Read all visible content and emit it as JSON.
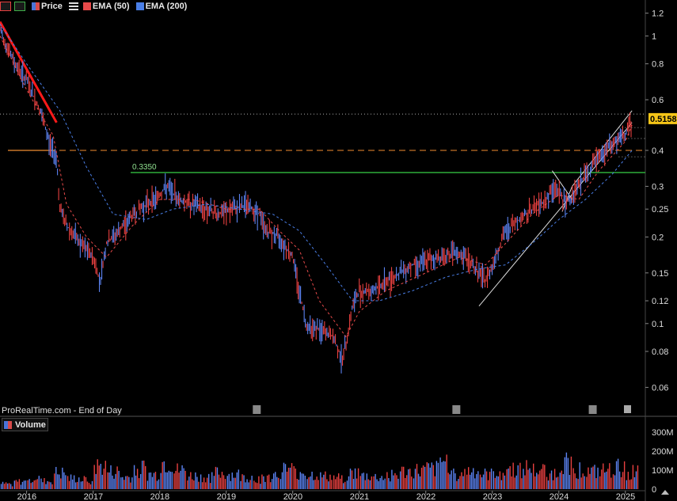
{
  "toolbar": {
    "price_label": "Price",
    "ema50_label": "EMA (50)",
    "ema200_label": "EMA (200)"
  },
  "watermark": "ProRealTime.com - End of Day",
  "volume_label": "Volume",
  "colors": {
    "background": "#000000",
    "up_bar": "#5b82f0",
    "down_bar": "#e84040",
    "ema50": "#e84a4a",
    "ema200": "#4a7fe8",
    "support_line": "#2fae3a",
    "orange_line": "#f08c30",
    "downtrend_line": "#ff1a1a",
    "price_badge": "#f5c518"
  },
  "price_badge": "0.5158",
  "support_label": "0.3350",
  "chart_data": [
    {
      "type": "line",
      "name": "price",
      "log_scale": true,
      "y_ticks": [
        "1.2",
        "1",
        "0.8",
        "0.6",
        "0.5158",
        "0.4",
        "0.3",
        "0.25",
        "0.2",
        "0.15",
        "0.12",
        "0.1",
        "0.08",
        "0.06"
      ],
      "y_tick_values": [
        1.2,
        1,
        0.8,
        0.6,
        0.4,
        0.3,
        0.25,
        0.2,
        0.15,
        0.12,
        0.1,
        0.08,
        0.06
      ],
      "x_ticks": [
        "2016",
        "2017",
        "2018",
        "2019",
        "2020",
        "2021",
        "2022",
        "2023",
        "2024",
        "2025"
      ],
      "x_tick_values": [
        2016,
        2017,
        2018,
        2019,
        2020,
        2021,
        2022,
        2023,
        2024,
        2025
      ],
      "xlim": [
        2015.6,
        2025.3
      ],
      "ylim": [
        0.052,
        1.3
      ],
      "series": [
        {
          "name": "Price",
          "x": [
            2015.6,
            2015.8,
            2016.0,
            2016.2,
            2016.35,
            2016.45,
            2016.5,
            2016.6,
            2016.8,
            2017.0,
            2017.1,
            2017.2,
            2017.4,
            2017.6,
            2017.8,
            2018.0,
            2018.1,
            2018.3,
            2018.5,
            2018.7,
            2018.9,
            2019.1,
            2019.3,
            2019.5,
            2019.6,
            2019.8,
            2020.0,
            2020.1,
            2020.2,
            2020.4,
            2020.6,
            2020.75,
            2020.8,
            2020.9,
            2021.0,
            2021.2,
            2021.4,
            2021.6,
            2021.8,
            2022.0,
            2022.2,
            2022.4,
            2022.6,
            2022.8,
            2022.9,
            2023.0,
            2023.2,
            2023.4,
            2023.6,
            2023.8,
            2023.95,
            2024.1,
            2024.2,
            2024.4,
            2024.6,
            2024.8,
            2025.0,
            2025.1
          ],
          "values": [
            1.05,
            0.82,
            0.7,
            0.55,
            0.42,
            0.38,
            0.25,
            0.22,
            0.19,
            0.17,
            0.14,
            0.19,
            0.21,
            0.24,
            0.26,
            0.28,
            0.3,
            0.27,
            0.26,
            0.25,
            0.24,
            0.25,
            0.26,
            0.24,
            0.21,
            0.2,
            0.17,
            0.13,
            0.1,
            0.095,
            0.09,
            0.075,
            0.085,
            0.115,
            0.13,
            0.13,
            0.14,
            0.15,
            0.16,
            0.165,
            0.17,
            0.175,
            0.17,
            0.15,
            0.14,
            0.16,
            0.21,
            0.23,
            0.25,
            0.27,
            0.3,
            0.26,
            0.28,
            0.33,
            0.38,
            0.42,
            0.45,
            0.51
          ]
        },
        {
          "name": "EMA (50)",
          "x": [
            2015.6,
            2016.0,
            2016.4,
            2016.6,
            2016.9,
            2017.2,
            2017.6,
            2018.0,
            2018.5,
            2019.0,
            2019.5,
            2019.8,
            2020.1,
            2020.4,
            2020.8,
            2021.0,
            2021.4,
            2022.0,
            2022.5,
            2022.9,
            2023.2,
            2023.6,
            2024.0,
            2024.3,
            2024.6,
            2025.0,
            2025.1
          ],
          "values": [
            1.0,
            0.65,
            0.45,
            0.26,
            0.2,
            0.17,
            0.22,
            0.27,
            0.27,
            0.25,
            0.25,
            0.21,
            0.18,
            0.12,
            0.09,
            0.11,
            0.13,
            0.15,
            0.17,
            0.16,
            0.19,
            0.24,
            0.28,
            0.27,
            0.34,
            0.43,
            0.49
          ]
        },
        {
          "name": "EMA (200)",
          "x": [
            2015.6,
            2016.0,
            2016.5,
            2016.9,
            2017.3,
            2017.8,
            2018.2,
            2018.7,
            2019.2,
            2019.7,
            2020.1,
            2020.5,
            2020.9,
            2021.3,
            2021.8,
            2022.3,
            2022.8,
            2023.2,
            2023.6,
            2024.0,
            2024.4,
            2024.8,
            2025.1
          ],
          "values": [
            1.1,
            0.8,
            0.55,
            0.35,
            0.24,
            0.23,
            0.25,
            0.26,
            0.25,
            0.24,
            0.21,
            0.16,
            0.12,
            0.12,
            0.13,
            0.145,
            0.155,
            0.16,
            0.19,
            0.23,
            0.27,
            0.33,
            0.4
          ]
        }
      ],
      "lines": {
        "support": 0.335,
        "orange": 0.4,
        "dotted_top": 0.535,
        "dotted_levels": [
          0.48,
          0.44,
          0.38
        ]
      }
    },
    {
      "type": "bar",
      "name": "volume",
      "y_ticks": [
        "300M",
        "200M",
        "100M",
        "0"
      ],
      "y_tick_values": [
        300,
        200,
        100,
        0
      ],
      "ylim": [
        0,
        350
      ],
      "x": [
        2015.7,
        2015.9,
        2016.1,
        2016.3,
        2016.5,
        2016.7,
        2016.9,
        2017.1,
        2017.3,
        2017.5,
        2017.7,
        2017.9,
        2018.1,
        2018.3,
        2018.5,
        2018.7,
        2018.9,
        2019.1,
        2019.3,
        2019.5,
        2019.7,
        2019.9,
        2020.1,
        2020.3,
        2020.5,
        2020.7,
        2020.9,
        2021.1,
        2021.3,
        2021.5,
        2021.7,
        2021.9,
        2022.1,
        2022.3,
        2022.5,
        2022.7,
        2022.9,
        2023.1,
        2023.3,
        2023.5,
        2023.7,
        2023.9,
        2024.1,
        2024.3,
        2024.5,
        2024.7,
        2024.9,
        2025.1
      ],
      "values": [
        40,
        55,
        90,
        60,
        120,
        80,
        70,
        170,
        130,
        90,
        160,
        110,
        200,
        140,
        100,
        90,
        120,
        110,
        90,
        80,
        100,
        150,
        130,
        110,
        95,
        85,
        120,
        100,
        90,
        110,
        130,
        140,
        150,
        210,
        120,
        140,
        110,
        130,
        150,
        160,
        140,
        120,
        200,
        150,
        130,
        140,
        160,
        130
      ]
    }
  ]
}
